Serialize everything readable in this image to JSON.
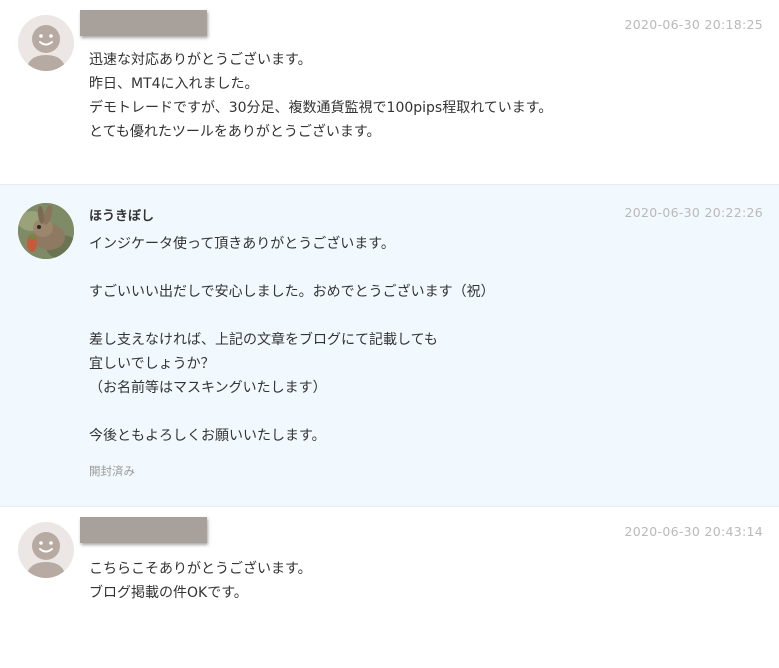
{
  "messages": [
    {
      "timestamp": "2020-06-30 20:18:25",
      "avatar": "default-user-avatar",
      "lines": [
        "迅速な対応ありがとうございます。",
        "昨日、MT4に入れました。",
        "デモトレードですが、30分足、複数通貨監視で100pips程取れています。",
        "とても優れたツールをありがとうございます。"
      ]
    },
    {
      "name": "ほうきぼし",
      "timestamp": "2020-06-30 20:22:26",
      "avatar": "rabbit-photo-avatar",
      "lines": [
        "インジケータ使って頂きありがとうございます。",
        "",
        "すごいいい出だしで安心しました。おめでとうございます（祝）",
        "",
        "差し支えなければ、上記の文章をブログにて記載しても",
        "宜しいでしょうか？",
        "（お名前等はマスキングいたします）",
        "",
        "今後ともよろしくお願いいたします。"
      ],
      "status": "開封済み"
    },
    {
      "timestamp": "2020-06-30 20:43:14",
      "avatar": "default-user-avatar",
      "lines": [
        "こちらこそありがとうございます。",
        "ブログ掲載の件OKです。"
      ]
    }
  ],
  "colors": {
    "highlight_bg": "#f2f9fe",
    "timestamp": "#b9b9b9",
    "name_mask": "#a8a19b",
    "avatar_default_bg": "#ece7e4",
    "avatar_default_fg": "#b7aaa2"
  }
}
